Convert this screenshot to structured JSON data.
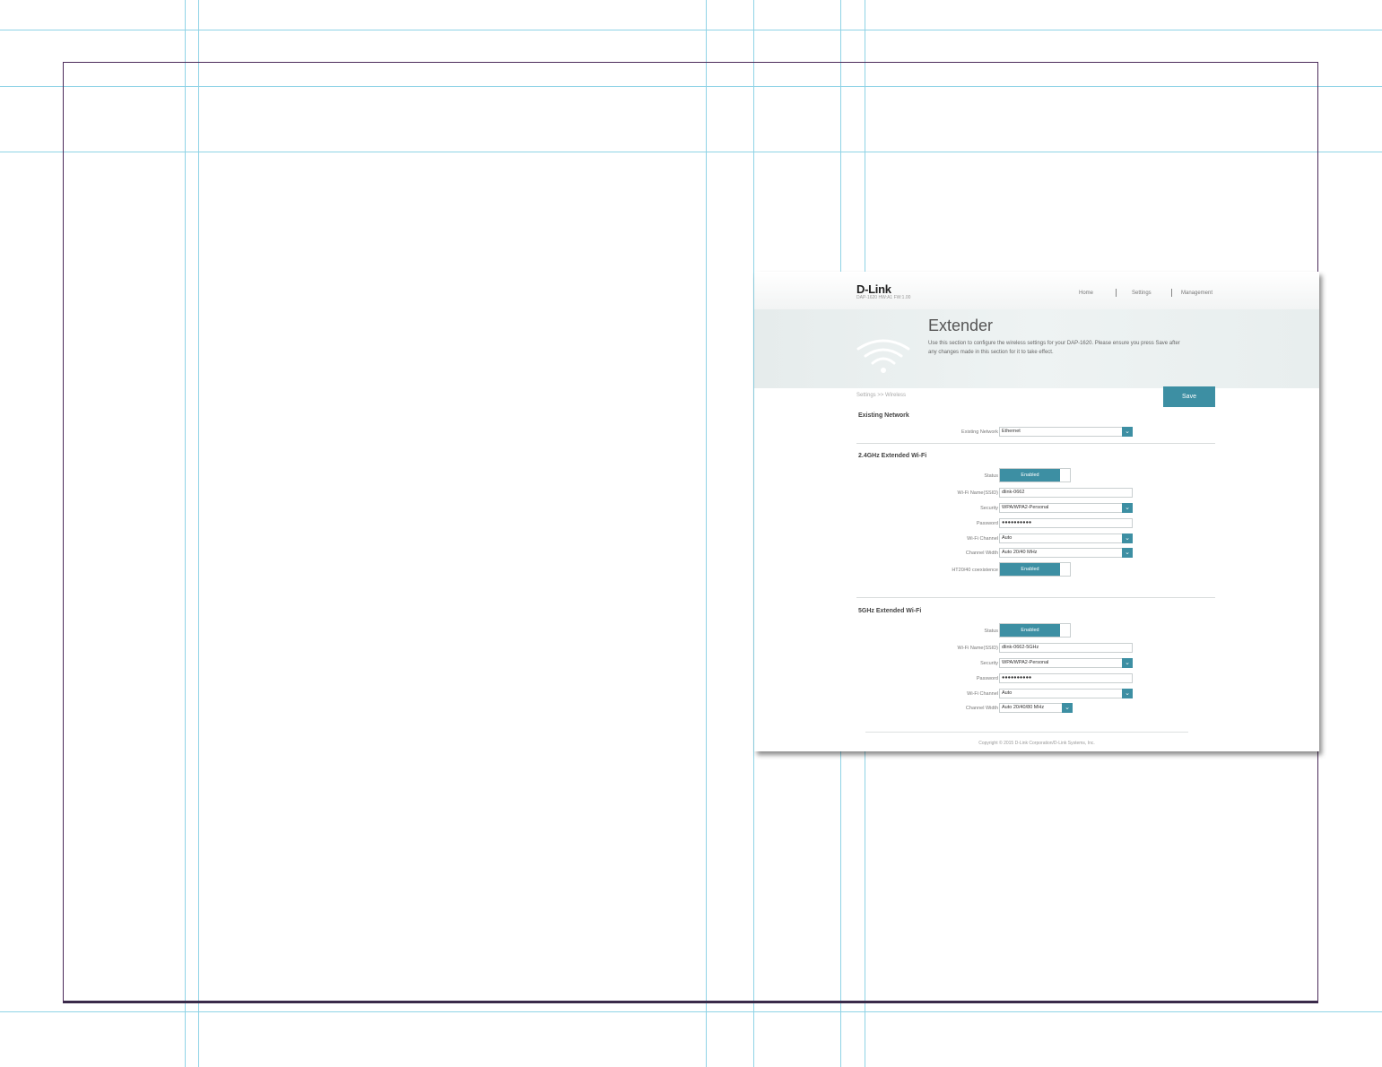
{
  "header": {
    "logo": "D-Link",
    "logo_sub": "DAP-1620   HW:A1   FW:1.00",
    "nav": [
      "Home",
      "Settings",
      "Management"
    ]
  },
  "hero": {
    "title": "Extender",
    "description": "Use this section to configure the wireless settings for your DAP-1620. Please ensure you press Save after any changes made in this section for it to take effect."
  },
  "breadcrumb": "Settings >> Wireless",
  "save_label": "Save",
  "existing": {
    "section_title": "Existing Network",
    "label": "Existing Network",
    "value": "Ethernet"
  },
  "wifi24": {
    "section_title": "2.4GHz Extended Wi-Fi",
    "status_label": "Status",
    "status_value": "Enabled",
    "ssid_label": "Wi-Fi Name(SSID)",
    "ssid_value": "dlink-0662",
    "security_label": "Security",
    "security_value": "WPA/WPA2-Personal",
    "password_label": "Password",
    "password_value": "●●●●●●●●●●",
    "channel_label": "Wi-Fi Channel",
    "channel_value": "Auto",
    "width_label": "Channel Width",
    "width_value": "Auto 20/40 MHz",
    "coexist_label": "HT20/40 coexistence",
    "coexist_value": "Enabled"
  },
  "wifi5": {
    "section_title": "5GHz Extended Wi-Fi",
    "status_label": "Status",
    "status_value": "Enabled",
    "ssid_label": "Wi-Fi Name(SSID)",
    "ssid_value": "dlink-0662-5GHz",
    "security_label": "Security",
    "security_value": "WPA/WPA2-Personal",
    "password_label": "Password",
    "password_value": "●●●●●●●●●●",
    "channel_label": "Wi-Fi Channel",
    "channel_value": "Auto",
    "width_label": "Channel Width",
    "width_value": "Auto 20/40/80 MHz"
  },
  "footer": "Copyright © 2015 D-Link Corporation/D-Link Systems, Inc.",
  "colors": {
    "accent": "#3d8fa3",
    "guide": "#8fd3e6"
  }
}
